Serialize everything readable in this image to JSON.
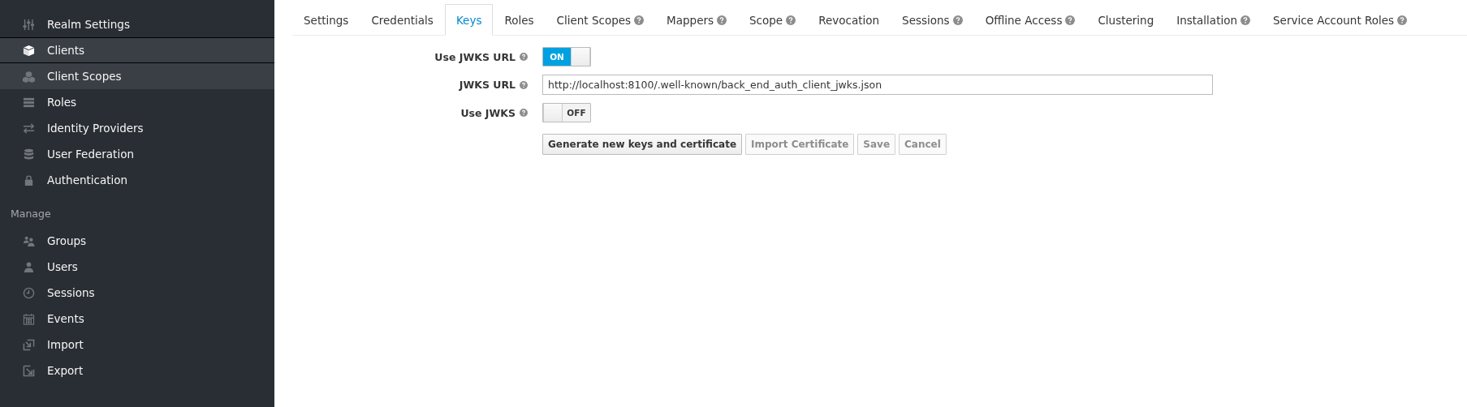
{
  "sidebar": {
    "sections": [
      {
        "items": [
          {
            "label": "Realm Settings",
            "selected": false,
            "hovered": false
          },
          {
            "label": "Clients",
            "selected": true,
            "hovered": false
          },
          {
            "label": "Client Scopes",
            "selected": false,
            "hovered": true
          },
          {
            "label": "Roles",
            "selected": false,
            "hovered": false
          },
          {
            "label": "Identity Providers",
            "selected": false,
            "hovered": false
          },
          {
            "label": "User Federation",
            "selected": false,
            "hovered": false
          },
          {
            "label": "Authentication",
            "selected": false,
            "hovered": false
          }
        ]
      },
      {
        "title": "Manage",
        "items": [
          {
            "label": "Groups",
            "selected": false,
            "hovered": false
          },
          {
            "label": "Users",
            "selected": false,
            "hovered": false
          },
          {
            "label": "Sessions",
            "selected": false,
            "hovered": false
          },
          {
            "label": "Events",
            "selected": false,
            "hovered": false
          },
          {
            "label": "Import",
            "selected": false,
            "hovered": false
          },
          {
            "label": "Export",
            "selected": false,
            "hovered": false
          }
        ]
      }
    ]
  },
  "tabs": [
    {
      "label": "Settings",
      "help": false,
      "selected": false
    },
    {
      "label": "Credentials",
      "help": false,
      "selected": false
    },
    {
      "label": "Keys",
      "help": false,
      "selected": true
    },
    {
      "label": "Roles",
      "help": false,
      "selected": false
    },
    {
      "label": "Client Scopes",
      "help": true,
      "selected": false
    },
    {
      "label": "Mappers",
      "help": true,
      "selected": false
    },
    {
      "label": "Scope",
      "help": true,
      "selected": false
    },
    {
      "label": "Revocation",
      "help": false,
      "selected": false
    },
    {
      "label": "Sessions",
      "help": true,
      "selected": false
    },
    {
      "label": "Offline Access",
      "help": true,
      "selected": false
    },
    {
      "label": "Clustering",
      "help": false,
      "selected": false
    },
    {
      "label": "Installation",
      "help": true,
      "selected": false
    },
    {
      "label": "Service Account Roles",
      "help": true,
      "selected": false
    }
  ],
  "form": {
    "fields": [
      {
        "kind": "toggle",
        "label": "Use JWKS URL",
        "on": true,
        "state_text": "ON"
      },
      {
        "kind": "text",
        "label": "JWKS URL",
        "value": "http://localhost:8100/.well-known/back_end_auth_client_jwks.json"
      },
      {
        "kind": "toggle",
        "label": "Use JWKS",
        "on": false,
        "state_text": "OFF"
      }
    ],
    "buttons": [
      {
        "label": "Generate new keys and certificate",
        "disabled": false
      },
      {
        "label": "Import Certificate",
        "disabled": true
      },
      {
        "label": "Save",
        "disabled": true
      },
      {
        "label": "Cancel",
        "disabled": true
      }
    ]
  }
}
